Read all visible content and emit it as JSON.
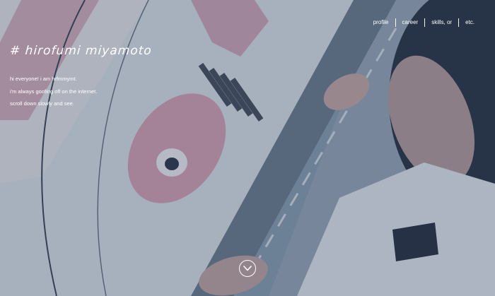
{
  "header": {
    "title": "# hirofumi miyamoto"
  },
  "nav": {
    "items": [
      {
        "label": "profile"
      },
      {
        "label": "career"
      },
      {
        "label": "skills, or"
      },
      {
        "label": "etc."
      }
    ]
  },
  "intro": {
    "lines": [
      "hi everyone! i am hrfmmymt.",
      "i'm always goofing off on the internet.",
      "scroll down slowly and see."
    ]
  },
  "scroll": {
    "icon": "chevron-down-icon"
  },
  "colors": {
    "text": "#ffffff",
    "overlay": "#1e3752"
  }
}
